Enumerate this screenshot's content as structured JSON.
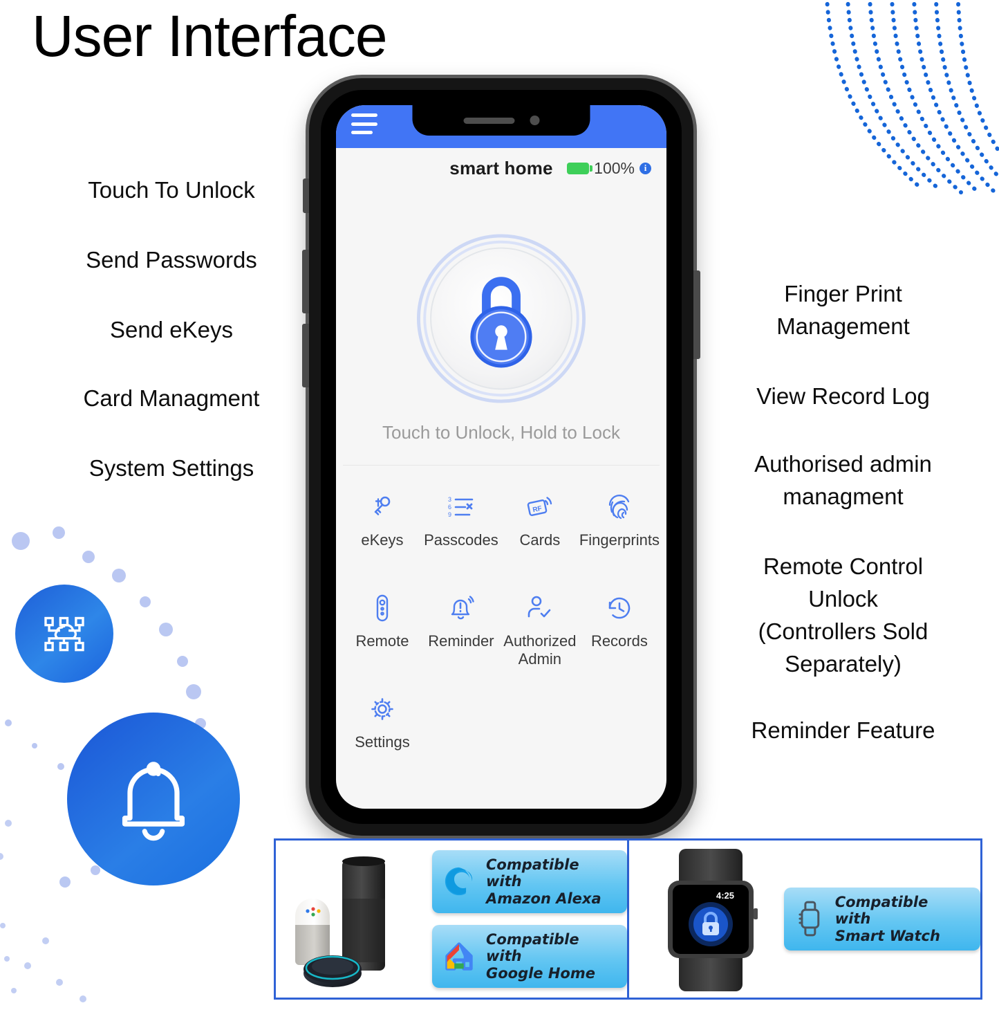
{
  "page": {
    "title": "User Interface"
  },
  "left_features": [
    "Touch To Unlock",
    "Send Passwords",
    "Send eKeys",
    "Card Managment",
    "System Settings"
  ],
  "right_features": [
    "Finger Print\nManagement",
    "View Record Log",
    "Authorised admin\nmanagment",
    "Remote Control\nUnlock\n(Controllers Sold\nSeparately)",
    "Reminder Feature"
  ],
  "phone": {
    "appbar": {
      "menu_icon": "hamburger-menu-icon"
    },
    "status": {
      "device_name": "smart home",
      "battery_icon": "battery-full-icon",
      "battery_level": "100%",
      "info_icon": "info-icon"
    },
    "lock": {
      "icon": "padlock-icon",
      "hint": "Touch to Unlock, Hold to Lock"
    },
    "grid": [
      {
        "label": "eKeys",
        "icon": "ekeys-icon"
      },
      {
        "label": "Passcodes",
        "icon": "passcodes-icon"
      },
      {
        "label": "Cards",
        "icon": "rf-card-icon"
      },
      {
        "label": "Fingerprints",
        "icon": "fingerprint-icon"
      },
      {
        "label": "Remote",
        "icon": "remote-control-icon"
      },
      {
        "label": "Reminder",
        "icon": "bell-alert-icon"
      },
      {
        "label": "Authorized\nAdmin",
        "icon": "user-check-icon"
      },
      {
        "label": "Records",
        "icon": "history-clock-icon"
      },
      {
        "label": "Settings",
        "icon": "gear-icon"
      }
    ]
  },
  "compatibility": {
    "left": {
      "devices_image": "smart-speakers-image",
      "badges": [
        {
          "icon": "amazon-alexa-icon",
          "line1": "Compatible with",
          "line2": "Amazon Alexa"
        },
        {
          "icon": "google-home-icon",
          "line1": "Compatible with",
          "line2": "Google Home"
        }
      ]
    },
    "right": {
      "devices_image": "smart-watch-image",
      "watch_time": "4:25",
      "badges": [
        {
          "icon": "smart-watch-icon",
          "line1": "Compatible with",
          "line2": "Smart Watch"
        }
      ]
    }
  },
  "decorations": {
    "cloud_network_badge": "cloud-network-icon",
    "bell_badge": "bell-icon"
  },
  "colors": {
    "brand_blue": "#4175f5",
    "accent_blue": "#2f62d6",
    "icon_blue": "#4e7ef0",
    "battery_green": "#3ecf59",
    "hint_grey": "#9a9a9a"
  }
}
